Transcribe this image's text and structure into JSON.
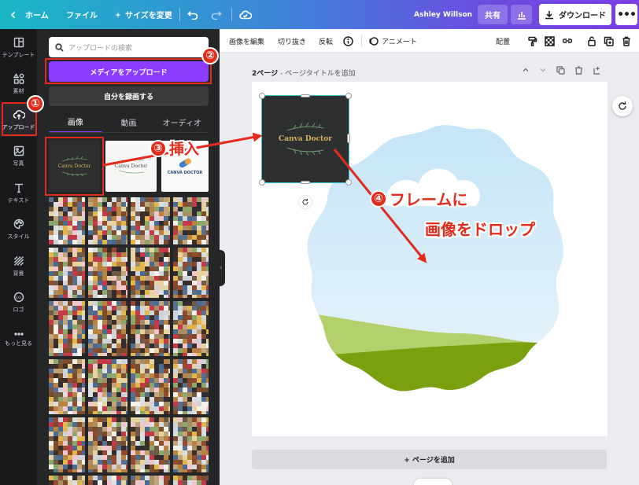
{
  "topbar": {
    "home": "ホーム",
    "file": "ファイル",
    "resize": "サイズを変更",
    "user_name": "Ashley Willson",
    "share": "共有",
    "download": "ダウンロード",
    "more": "•••"
  },
  "rail": {
    "items": [
      {
        "label": "テンプレート",
        "icon": "template-icon"
      },
      {
        "label": "素材",
        "icon": "elements-icon"
      },
      {
        "label": "アップロード",
        "icon": "upload-cloud-icon"
      },
      {
        "label": "写真",
        "icon": "photo-icon"
      },
      {
        "label": "テキスト",
        "icon": "text-icon"
      },
      {
        "label": "スタイル",
        "icon": "palette-icon"
      },
      {
        "label": "背景",
        "icon": "background-icon"
      },
      {
        "label": "ロゴ",
        "icon": "logo-icon"
      },
      {
        "label": "もっと見る",
        "icon": "more-dots-icon"
      }
    ]
  },
  "panel": {
    "search_placeholder": "アップロードの検索",
    "upload_button": "メディアをアップロード",
    "record_button": "自分を録画する",
    "tabs": [
      "画像",
      "動画",
      "オーディオ"
    ],
    "active_tab": "画像",
    "thumb1_title": "Canva Doctor",
    "thumb2_title": "Canva Doctor",
    "thumb3_title": "CANVA DOCTOR"
  },
  "toolbar2": {
    "edit_image": "画像を編集",
    "crop": "切り抜き",
    "flip": "反転",
    "animate": "アニメート",
    "position": "配置"
  },
  "canvas": {
    "page_label": "2ページ",
    "page_title_placeholder": "ページタイトルを追加",
    "placed_image_title": "Canva Doctor",
    "add_page": "+ ページを追加"
  },
  "annotations": {
    "num1": "①",
    "num2": "②",
    "num3": "③",
    "label3": "挿入",
    "num4": "④",
    "label4_line1": "フレームに",
    "label4_line2": "画像をドロップ"
  },
  "colors": {
    "accent_purple": "#8b3dff",
    "annotation_red": "#e32a1b",
    "dark_panel": "#252627",
    "rail_bg": "#18191b"
  }
}
